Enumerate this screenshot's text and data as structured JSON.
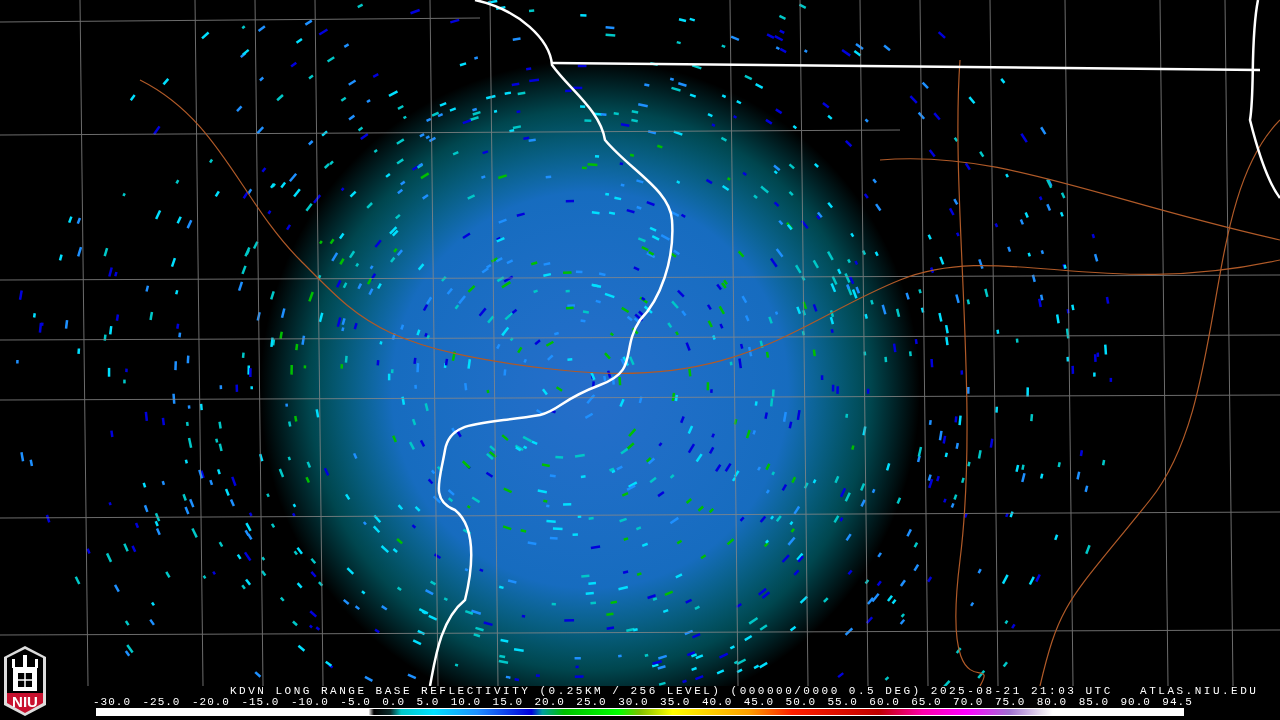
{
  "logo": {
    "text": "NIU"
  },
  "caption": "KDVN LONG RANGE BASE REFLECTIVITY (0.25KM / 256 LEVEL) (000000/0000 0.5 DEG) 2025-08-21 21:03 UTC   ATLAS.NIU.EDU",
  "scale": {
    "labels": [
      "-30.0",
      "-25.0",
      "-20.0",
      "-15.0",
      "-10.0",
      "-5.0",
      "0.0",
      "5.0",
      "10.0",
      "15.0",
      "20.0",
      "25.0",
      "30.0",
      "35.0",
      "40.0",
      "45.0",
      "50.0",
      "55.0",
      "60.0",
      "65.0",
      "70.0",
      "75.0",
      "80.0",
      "85.0",
      "90.0",
      "94.5"
    ]
  }
}
